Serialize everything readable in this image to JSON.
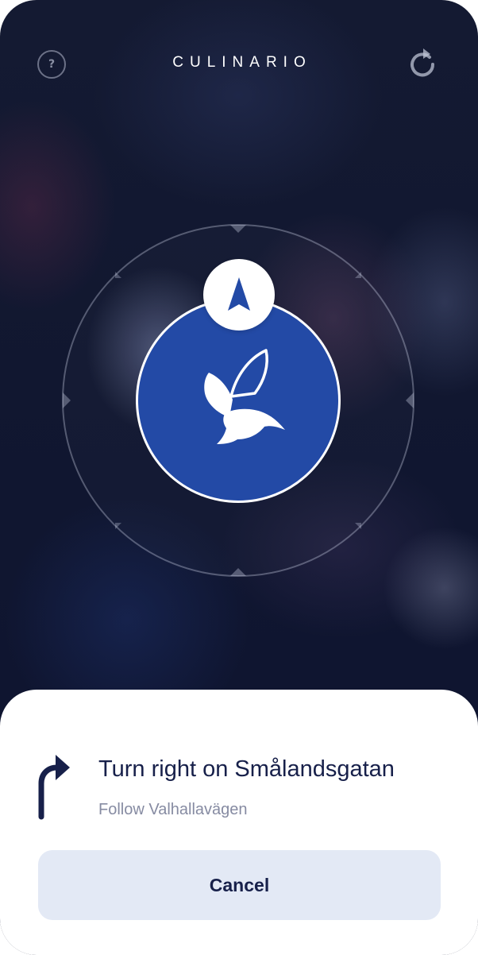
{
  "header": {
    "help_glyph": "?",
    "brand": "CULINARIO",
    "help_icon": "question-circle-icon",
    "refresh_icon": "refresh-icon"
  },
  "compass": {
    "pointer_icon": "navigation-arrow-icon",
    "center_icon": "bird-logo-icon",
    "accent_color": "#234aa6"
  },
  "navigation": {
    "turn_icon": "turn-right-arrow-icon",
    "instruction": "Turn right on Smålandsgatan",
    "subtitle": "Follow Valhallavägen"
  },
  "actions": {
    "cancel_label": "Cancel"
  }
}
